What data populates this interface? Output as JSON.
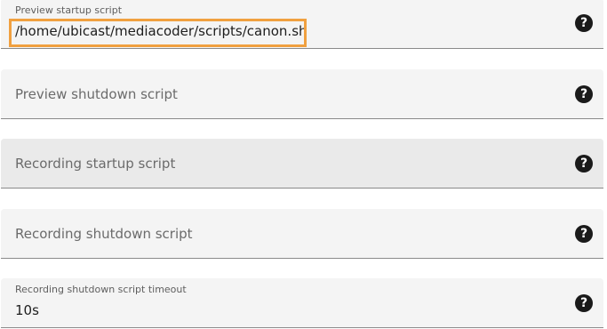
{
  "fields": [
    {
      "label": "Preview startup script",
      "value": "/home/ubicast/mediacoder/scripts/canon.sh",
      "help_icon": "help-circle-icon",
      "help_glyph": "?"
    },
    {
      "label": "Preview shutdown script",
      "value": "",
      "help_icon": "help-circle-icon",
      "help_glyph": "?"
    },
    {
      "label": "Recording startup script",
      "value": "",
      "help_icon": "help-circle-icon",
      "help_glyph": "?"
    },
    {
      "label": "Recording shutdown script",
      "value": "",
      "help_icon": "help-circle-icon",
      "help_glyph": "?"
    },
    {
      "label": "Recording shutdown script timeout",
      "value": "10s",
      "help_icon": "help-circle-icon",
      "help_glyph": "?"
    }
  ],
  "colors": {
    "field_background": "#f4f4f4",
    "field_hover_background": "#eaeaea",
    "highlight_border": "#f0a040",
    "help_icon_background": "#1a1a1a"
  }
}
